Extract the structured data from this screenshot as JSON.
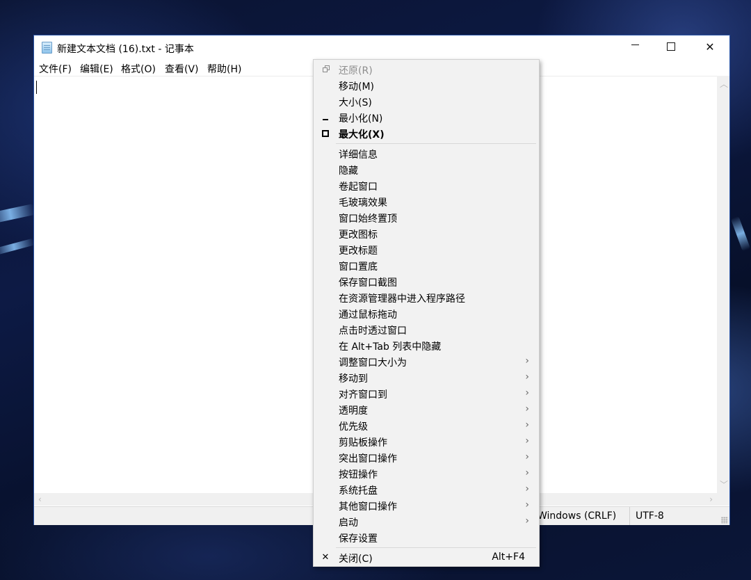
{
  "window": {
    "title": "新建文本文档 (16).txt - 记事本",
    "controls": {
      "minimize": "minimize",
      "maximize": "maximize",
      "close": "close"
    }
  },
  "menubar": {
    "items": [
      "文件(F)",
      "编辑(E)",
      "格式(O)",
      "查看(V)",
      "帮助(H)"
    ]
  },
  "statusbar": {
    "line_ending": "Windows (CRLF)",
    "encoding": "UTF-8"
  },
  "context_menu": {
    "items": [
      {
        "label": "还原(R)",
        "icon": "restore-icon",
        "disabled": true
      },
      {
        "label": "移动(M)"
      },
      {
        "label": "大小(S)"
      },
      {
        "label": "最小化(N)",
        "icon": "minimize-icon"
      },
      {
        "label": "最大化(X)",
        "icon": "maximize-icon",
        "bold": true
      },
      {
        "label": "详细信息"
      },
      {
        "label": "隐藏"
      },
      {
        "label": "卷起窗口"
      },
      {
        "label": "毛玻璃效果"
      },
      {
        "label": "窗口始终置顶"
      },
      {
        "label": "更改图标"
      },
      {
        "label": "更改标题"
      },
      {
        "label": "窗口置底"
      },
      {
        "label": "保存窗口截图"
      },
      {
        "label": "在资源管理器中进入程序路径"
      },
      {
        "label": "通过鼠标拖动"
      },
      {
        "label": "点击时透过窗口"
      },
      {
        "label": "在 Alt+Tab 列表中隐藏"
      },
      {
        "label": "调整窗口大小为",
        "submenu": true
      },
      {
        "label": "移动到",
        "submenu": true
      },
      {
        "label": "对齐窗口到",
        "submenu": true
      },
      {
        "label": "透明度",
        "submenu": true
      },
      {
        "label": "优先级",
        "submenu": true
      },
      {
        "label": "剪贴板操作",
        "submenu": true
      },
      {
        "label": "突出窗口操作",
        "submenu": true
      },
      {
        "label": "按钮操作",
        "submenu": true
      },
      {
        "label": "系统托盘",
        "submenu": true
      },
      {
        "label": "其他窗口操作",
        "submenu": true
      },
      {
        "label": "启动",
        "submenu": true
      },
      {
        "label": "保存设置"
      },
      {
        "label": "关闭(C)",
        "icon": "close-icon",
        "shortcut": "Alt+F4"
      }
    ]
  },
  "colors": {
    "menu_background": "#f2f2f2",
    "window_border": "#2b56a8",
    "disabled_text": "#8d8d8d"
  }
}
